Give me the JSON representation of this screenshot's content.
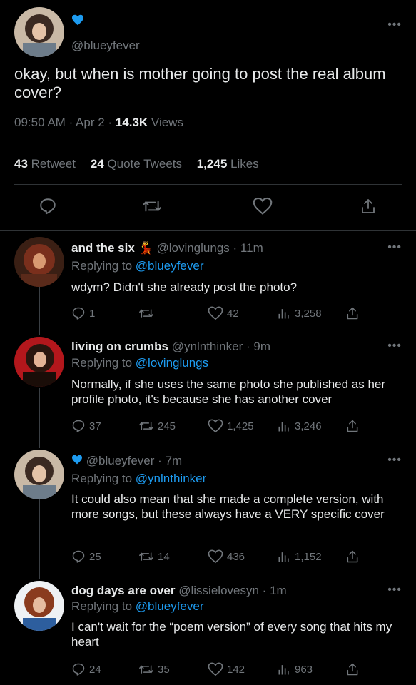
{
  "main_tweet": {
    "handle": "@blueyfever",
    "text": "okay, but when is mother going to post the real album cover?",
    "time": "09:50 AM",
    "dot1": "·",
    "date": "Apr 2",
    "dot2": "·",
    "views_count": "14.3K",
    "views_label": "Views",
    "retweets_count": "43",
    "retweets_label": "Retweet",
    "quotes_count": "24",
    "quotes_label": "Quote Tweets",
    "likes_count": "1,245",
    "likes_label": "Likes",
    "heart_emoji": "💙"
  },
  "replies": [
    {
      "name": "and the six",
      "emoji": "💃",
      "handle": "@lovinglungs",
      "dot": "·",
      "time": "11m",
      "replying_prefix": "Replying to",
      "replying_to": "@blueyfever",
      "text": "wdym? Didn't she already post the photo?",
      "replies": "1",
      "retweets": "",
      "likes": "42",
      "views": "3,258"
    },
    {
      "name": "living on crumbs",
      "emoji": "",
      "handle": "@ynlnthinker",
      "dot": "·",
      "time": "9m",
      "replying_prefix": "Replying to",
      "replying_to": "@lovinglungs",
      "text": "Normally, if she uses the same photo she published as her profile photo, it's because she has another cover",
      "replies": "37",
      "retweets": "245",
      "likes": "1,425",
      "views": "3,246"
    },
    {
      "name": "",
      "emoji": "💙",
      "handle": "@blueyfever",
      "dot": "·",
      "time": "7m",
      "replying_prefix": "Replying to",
      "replying_to": "@ynlnthinker",
      "text": "It could also mean that she made a complete version, with more songs, but these always have a VERY specific cover",
      "replies": "25",
      "retweets": "14",
      "likes": "436",
      "views": "1,152"
    },
    {
      "name": "dog days are over",
      "emoji": "",
      "handle": "@lissielovesyn",
      "dot": "·",
      "time": "1m",
      "replying_prefix": "Replying to",
      "replying_to": "@blueyfever",
      "text": "I can't wait for the “poem version” of every song that hits my heart",
      "replies": "24",
      "retweets": "35",
      "likes": "142",
      "views": "963"
    }
  ],
  "icons": {
    "more": "•••"
  },
  "colors": {
    "accent": "#1d9bf0",
    "muted": "#71767b",
    "text": "#e7e9ea",
    "background": "#000000"
  }
}
